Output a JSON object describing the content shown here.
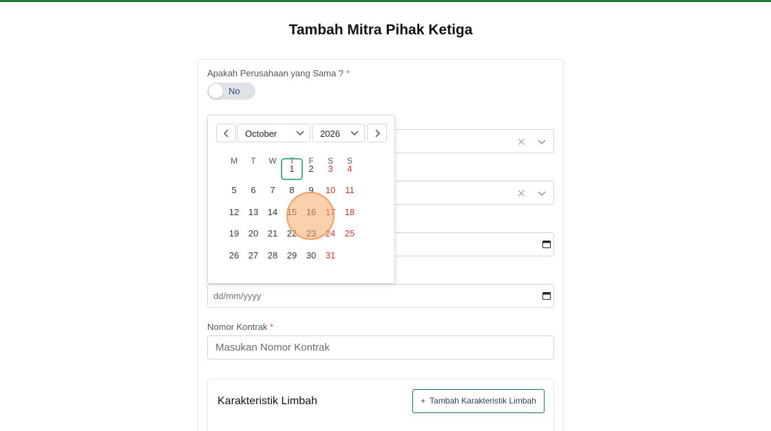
{
  "page": {
    "title": "Tambah Mitra Pihak Ketiga"
  },
  "form": {
    "same_company_label": "Apakah Perusahaan yang Sama ?",
    "required_mark": "*",
    "toggle_value": "No",
    "date_placeholder": "dd/mm/yyyy",
    "contract_label": "Nomor Kontrak",
    "contract_placeholder": "Masukan Nomor Kontrak"
  },
  "waste": {
    "title": "Karakteristik Limbah",
    "add_label": "Tambah Karakteristik Limbah",
    "add_plus": "+"
  },
  "datepicker": {
    "month": "October",
    "year": "2026",
    "weekdays": [
      "M",
      "T",
      "W",
      "T",
      "F",
      "S",
      "S"
    ],
    "today": "1",
    "weeks": [
      [
        "",
        "",
        "",
        "1",
        "2",
        "3",
        "4"
      ],
      [
        "5",
        "6",
        "7",
        "8",
        "9",
        "10",
        "11"
      ],
      [
        "12",
        "13",
        "14",
        "15",
        "16",
        "17",
        "18"
      ],
      [
        "19",
        "20",
        "21",
        "22",
        "23",
        "24",
        "25"
      ],
      [
        "26",
        "27",
        "28",
        "29",
        "30",
        "31",
        ""
      ]
    ]
  },
  "colors": {
    "accent": "#1e7a3e",
    "weekend": "#c0392b",
    "today_border": "#4caf8c"
  }
}
